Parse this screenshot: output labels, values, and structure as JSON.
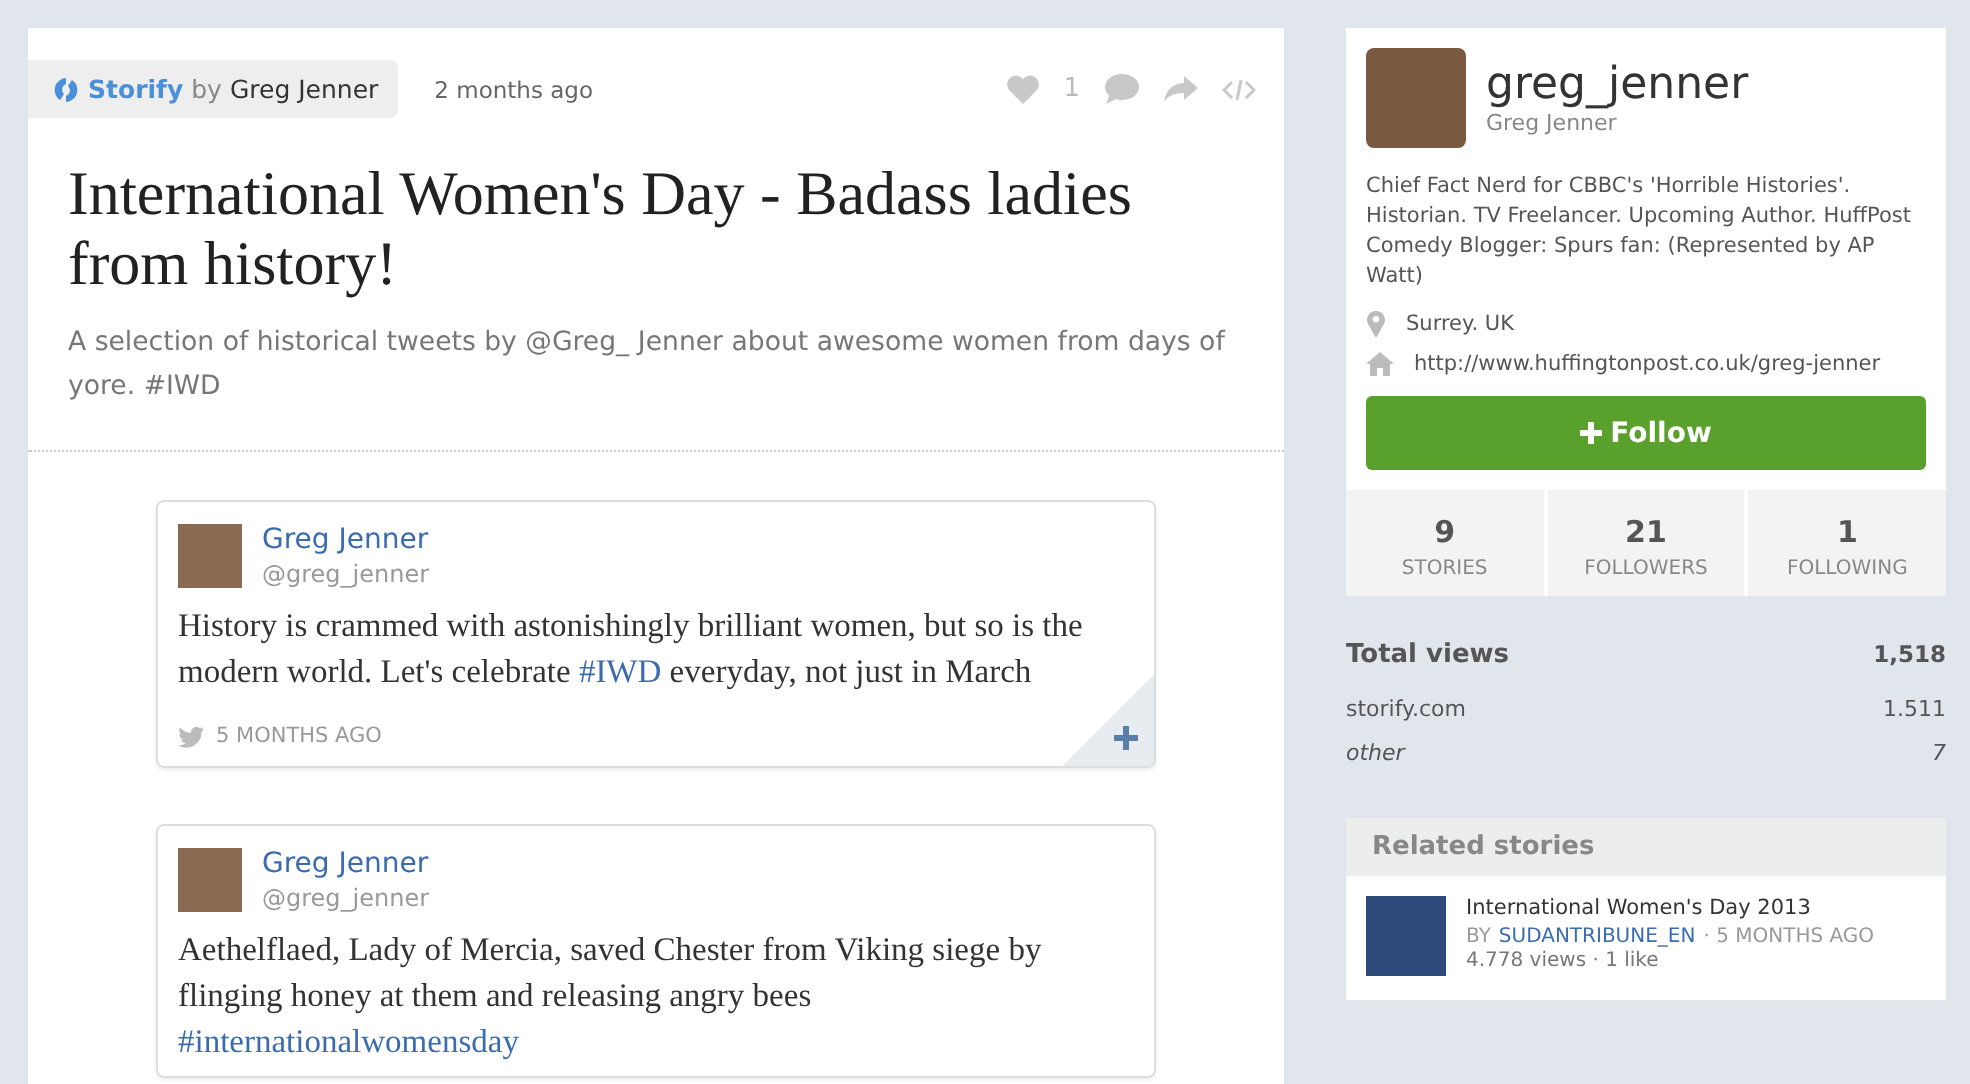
{
  "story": {
    "badge": {
      "brand": "Storify",
      "by": "by",
      "author": "Greg Jenner"
    },
    "time": "2 months ago",
    "likes": "1",
    "title": "International Women's Day - Badass ladies from history!",
    "description": "A selection of historical tweets by @Greg_ Jenner about awesome women from days of yore. #IWD",
    "tweets": [
      {
        "name": "Greg Jenner",
        "handle": "@greg_jenner",
        "text": [
          {
            "kind": "plain",
            "text": "History is crammed with astonishingly brilliant women, but so is the modern world. Let's celebrate "
          },
          {
            "kind": "hashtag",
            "text": "#IWD"
          },
          {
            "kind": "plain",
            "text": " everyday, not just in March"
          }
        ],
        "time": "5 MONTHS AGO"
      },
      {
        "name": "Greg Jenner",
        "handle": "@greg_jenner",
        "text": [
          {
            "kind": "plain",
            "text": "Aethelflaed, Lady of Mercia, saved Chester from Viking siege by flinging honey at them and releasing angry bees "
          },
          {
            "kind": "hashtag",
            "text": "#internationalwomensday"
          }
        ]
      }
    ]
  },
  "profile": {
    "username": "greg_jenner",
    "name": "Greg Jenner",
    "bio": "Chief Fact Nerd for CBBC's 'Horrible Histories'. Historian. TV Freelancer. Upcoming Author. HuffPost Comedy Blogger: Spurs fan: (Represented by AP Watt)",
    "location": "Surrey. UK",
    "website": "http://www.huffingtonpost.co.uk/greg-jenner",
    "follow": "Follow",
    "stats": [
      {
        "value": "9",
        "label": "STORIES"
      },
      {
        "value": "21",
        "label": "FOLLOWERS"
      },
      {
        "value": "1",
        "label": "FOLLOWING"
      }
    ]
  },
  "views": {
    "label": "Total views",
    "value": "1,518",
    "sources": [
      {
        "kind": "site",
        "label": "storify.com",
        "value": "1.511"
      },
      {
        "kind": "other",
        "label": "other",
        "value": "7"
      }
    ]
  },
  "related": {
    "title": "Related stories",
    "items": [
      {
        "title": "International Women's Day 2013",
        "by": "BY",
        "author": "SUDANTRIBUNE_EN",
        "time": "· 5 MONTHS AGO",
        "stats": "4.778 views · 1 like"
      }
    ]
  }
}
